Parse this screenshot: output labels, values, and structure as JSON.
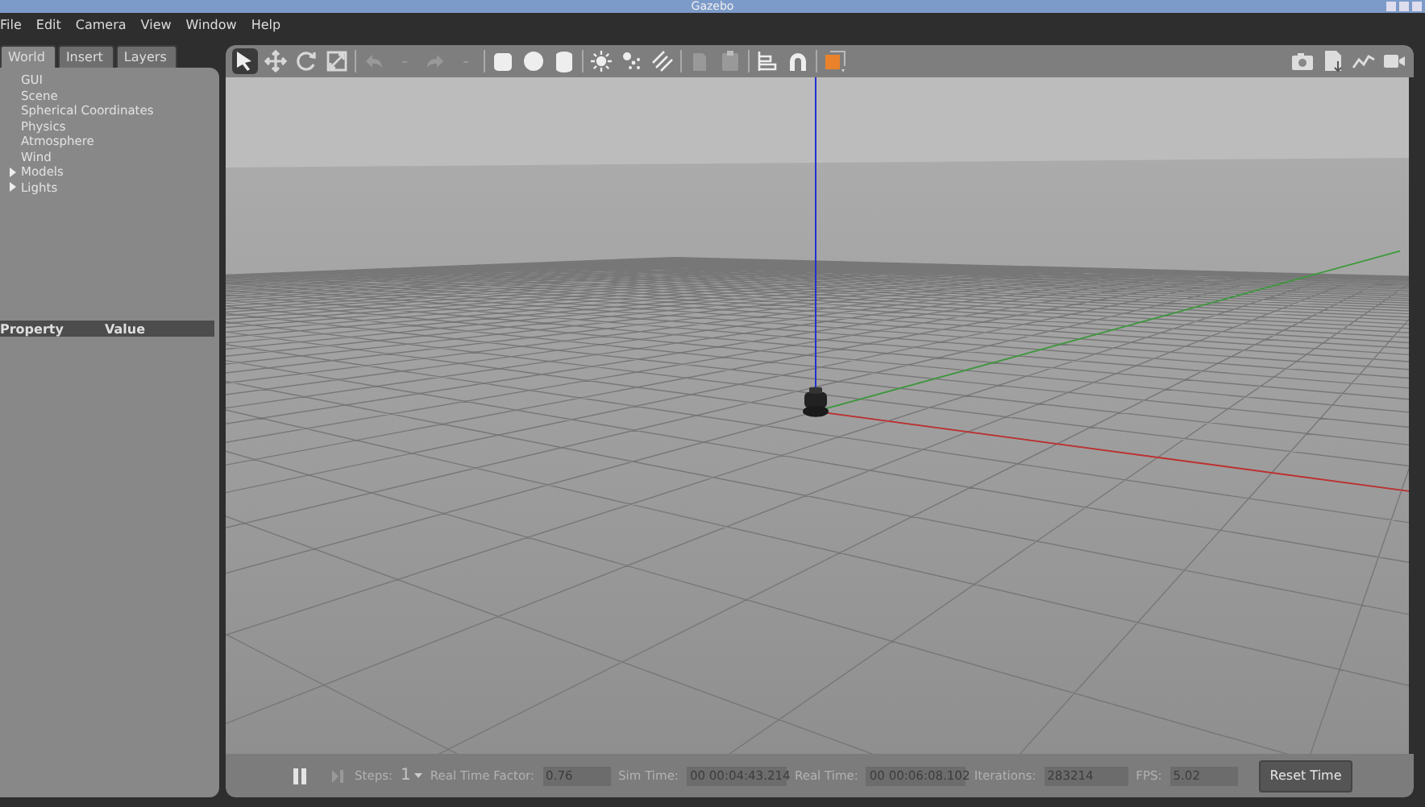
{
  "window": {
    "title": "Gazebo"
  },
  "menu": [
    "File",
    "Edit",
    "Camera",
    "View",
    "Window",
    "Help"
  ],
  "tabs": [
    {
      "label": "World",
      "selected": true
    },
    {
      "label": "Insert",
      "selected": false
    },
    {
      "label": "Layers",
      "selected": false
    }
  ],
  "tree": [
    {
      "label": "GUI",
      "kind": "leaf"
    },
    {
      "label": "Scene",
      "kind": "leaf"
    },
    {
      "label": "Spherical Coordinates",
      "kind": "leaf"
    },
    {
      "label": "Physics",
      "kind": "leaf"
    },
    {
      "label": "Atmosphere",
      "kind": "leaf"
    },
    {
      "label": "Wind",
      "kind": "leaf"
    },
    {
      "label": "Models",
      "kind": "group",
      "expanded": false
    },
    {
      "label": "Lights",
      "kind": "group",
      "expanded": false
    }
  ],
  "properties": {
    "columns": [
      "Property",
      "Value"
    ]
  },
  "toolbar": [
    {
      "kind": "select",
      "selected": true
    },
    {
      "kind": "translate",
      "selected": false
    },
    {
      "kind": "rotate",
      "selected": false
    },
    {
      "kind": "scale",
      "selected": false
    },
    {
      "kind": "sep"
    },
    {
      "kind": "undo"
    },
    {
      "kind": "drop"
    },
    {
      "kind": "redo"
    },
    {
      "kind": "drop"
    },
    {
      "kind": "sep"
    },
    {
      "kind": "box"
    },
    {
      "kind": "sphere"
    },
    {
      "kind": "cylinder"
    },
    {
      "kind": "sep"
    },
    {
      "kind": "pointlight"
    },
    {
      "kind": "spotlight"
    },
    {
      "kind": "dirlight"
    },
    {
      "kind": "sep"
    },
    {
      "kind": "copy"
    },
    {
      "kind": "paste"
    },
    {
      "kind": "sep"
    },
    {
      "kind": "align"
    },
    {
      "kind": "snap"
    },
    {
      "kind": "sep"
    },
    {
      "kind": "view"
    }
  ],
  "toolbar_right": [
    {
      "kind": "camera"
    },
    {
      "kind": "log"
    },
    {
      "kind": "plot"
    },
    {
      "kind": "video"
    }
  ],
  "bottom": {
    "steps_label": "Steps:",
    "steps": "1",
    "fields": [
      {
        "label": "Real Time Factor:",
        "value": "0.76"
      },
      {
        "label": "Sim Time:",
        "value": "00 00:04:43.214"
      },
      {
        "label": "Real Time:",
        "value": "00 00:06:08.102"
      },
      {
        "label": "Iterations:",
        "value": "283214"
      },
      {
        "label": "FPS:",
        "value": "5.02"
      }
    ],
    "reset": "Reset Time"
  }
}
